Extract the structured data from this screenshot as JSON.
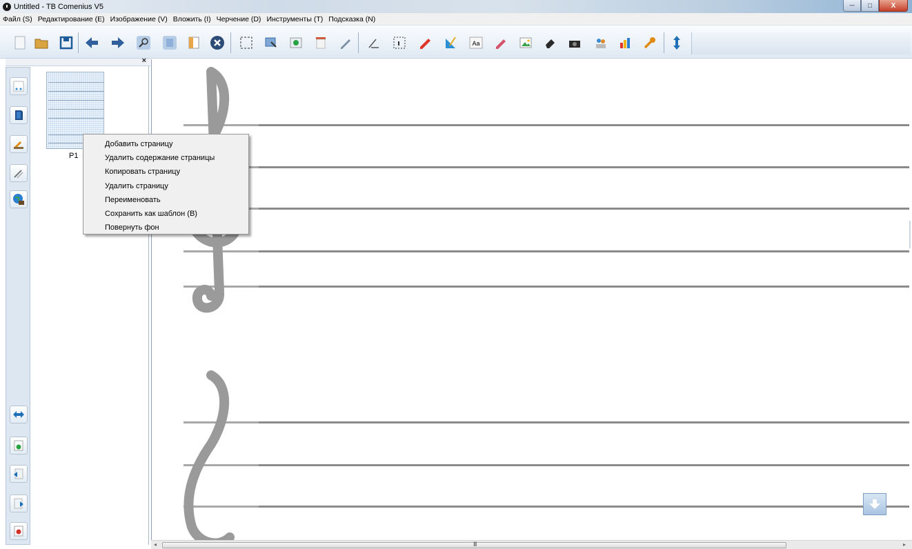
{
  "window": {
    "title": "Untitled - TB Comenius V5",
    "buttons": {
      "minimize": "─",
      "maximize": "□",
      "close": "X"
    }
  },
  "menubar": {
    "items": [
      "Файл (S)",
      "Редактирование (E)",
      "Изображение (V)",
      "Вложить (I)",
      "Черчение (D)",
      "Инструменты (T)",
      "Подсказка (N)"
    ]
  },
  "toolbar": {
    "icons": [
      "new-page-icon",
      "open-folder-icon",
      "save-icon",
      "previous-page-icon",
      "next-page-icon",
      "zoom-icon",
      "page-layout-icon",
      "note-icon",
      "stop-icon",
      "select-area-icon",
      "screen-capture-icon",
      "record-icon",
      "curtain-icon",
      "pen-icon",
      "freehand-pen-icon",
      "region-select-icon",
      "highlighter-icon",
      "ruler-icon",
      "text-icon",
      "eraser-pen-icon",
      "image-icon",
      "eraser-icon",
      "camera-icon",
      "people-icon",
      "chart-icon",
      "settings-wrench-icon",
      "expand-vertical-icon"
    ],
    "text_icon_label": "Aa"
  },
  "page_panel": {
    "close_label": "×",
    "pages": [
      {
        "label": "P1"
      }
    ]
  },
  "left_strip": {
    "top_icons": [
      "background-icon",
      "book-icon",
      "tools-icon",
      "pencil-tools-icon",
      "web-globe-icon"
    ],
    "bottom_icons": [
      "swap-arrows-icon",
      "add-page-icon",
      "previous-page-icon",
      "next-page-icon",
      "delete-page-icon"
    ]
  },
  "context_menu": {
    "items": [
      "Добавить страницу",
      "Удалить содержание страницы",
      "Копировать страницу",
      "Удалить страницу",
      "Переименовать",
      "Сохранить как шаблон (B)",
      "Повернуть фон"
    ]
  },
  "scrollbar": {
    "grip": "III",
    "left_arrow": "◂",
    "right_arrow": "▸"
  },
  "colors": {
    "staff_line": "#8a8a8a",
    "clef": "#9a9a9a",
    "menu_background": "#f0f0f0",
    "titlebar_close": "#c4402a"
  }
}
